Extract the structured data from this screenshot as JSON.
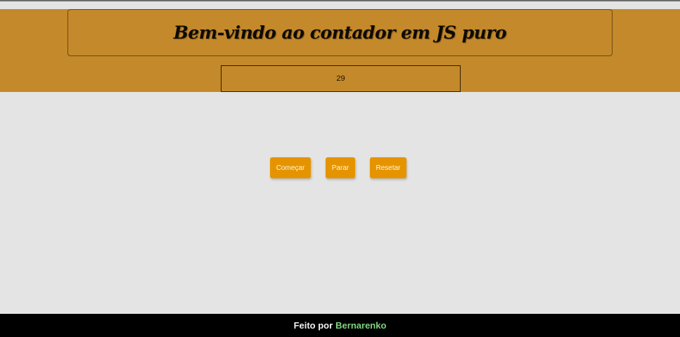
{
  "header": {
    "title": "Bem-vindo ao contador em JS puro",
    "band_color": "#c4892a"
  },
  "counter": {
    "value": "29"
  },
  "controls": {
    "start_label": "Começar",
    "stop_label": "Parar",
    "reset_label": "Resetar",
    "button_color": "#e59400"
  },
  "footer": {
    "prefix": "Feito por",
    "author": "Bernarenko",
    "author_color": "#7ed47e"
  }
}
